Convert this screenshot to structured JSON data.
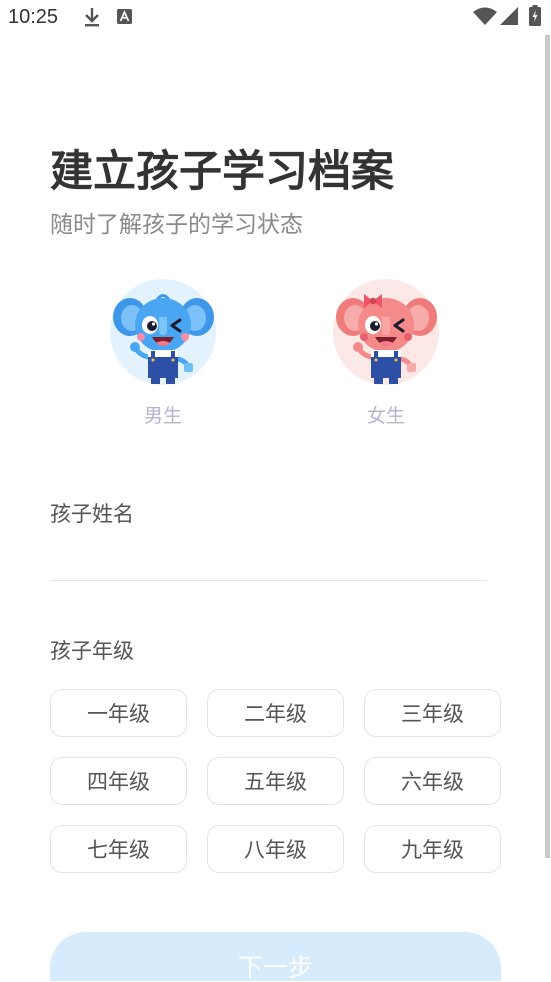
{
  "status_bar": {
    "time": "10:25",
    "icons": [
      "download-icon",
      "text-a-icon",
      "wifi-icon",
      "signal-icon",
      "battery-charging-icon"
    ]
  },
  "header": {
    "title": "建立孩子学习档案",
    "subtitle": "随时了解孩子的学习状态"
  },
  "gender": {
    "options": [
      {
        "label": "男生",
        "avatar_icon": "blue-elephant-boy-icon"
      },
      {
        "label": "女生",
        "avatar_icon": "pink-elephant-girl-icon"
      }
    ]
  },
  "name_field": {
    "label": "孩子姓名",
    "value": ""
  },
  "grade": {
    "label": "孩子年级",
    "options": [
      "一年级",
      "二年级",
      "三年级",
      "四年级",
      "五年级",
      "六年级",
      "七年级",
      "八年级",
      "九年级"
    ]
  },
  "next_button": {
    "label": "下一步"
  },
  "colors": {
    "title_text": "#333333",
    "subtitle_text": "#8a8a8a",
    "gender_label": "#b4b4d0",
    "boy_avatar_bg": "#e3f2fd",
    "girl_avatar_bg": "#fde8e8",
    "button_bg": "#d6ebfb",
    "button_text": "#ffffff"
  }
}
